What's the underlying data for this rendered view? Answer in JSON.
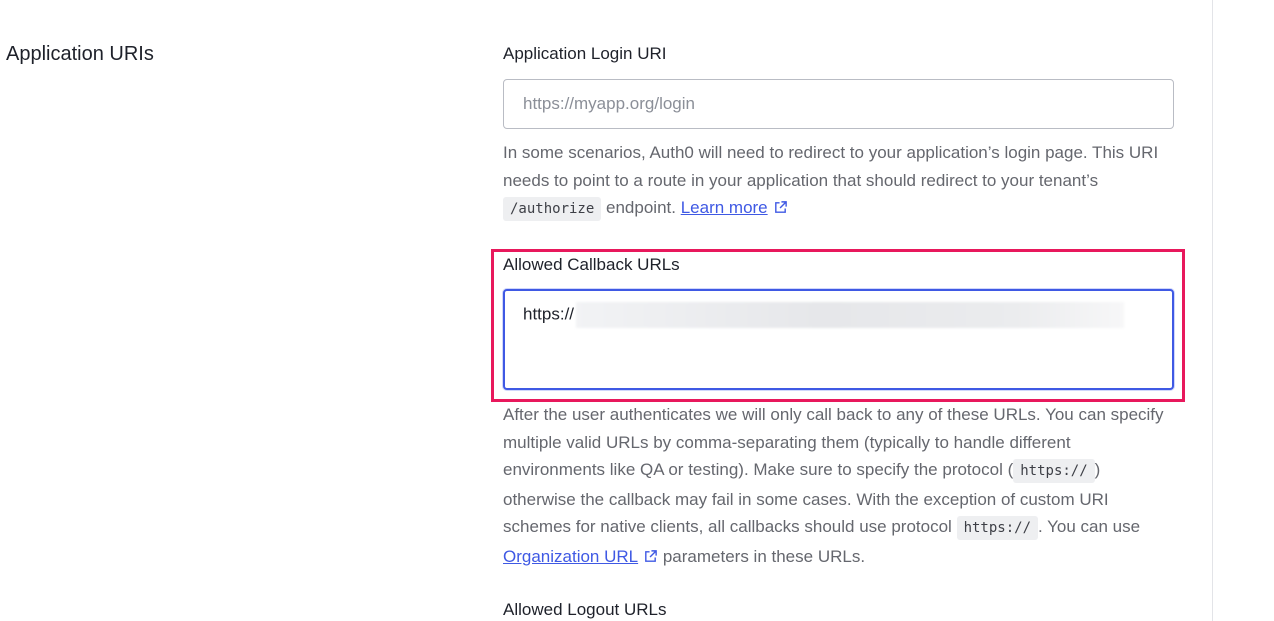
{
  "section": {
    "title": "Application URIs"
  },
  "login_uri": {
    "label": "Application Login URI",
    "placeholder": "https://myapp.org/login",
    "help": {
      "text1": "In some scenarios, Auth0 will need to redirect to your application’s login page. This URI needs to point to a route in your application that should redirect to your tenant’s ",
      "code": "/authorize",
      "text2": " endpoint. ",
      "link": "Learn more",
      "link_icon": "external-link-icon"
    }
  },
  "callback_urls": {
    "label": "Allowed Callback URLs",
    "value": "https://",
    "help": {
      "text1": "After the user authenticates we will only call back to any of these URLs. You can specify multiple valid URLs by comma-separating them (typically to handle different environments like QA or testing). Make sure to specify the protocol (",
      "code1": "https://",
      "text2": ") otherwise the callback may fail in some cases. With the exception of custom URI schemes for native clients, all callbacks should use protocol ",
      "code2": "https://",
      "text3": ". You can use ",
      "link": "Organization URL",
      "link_icon": "external-link-icon",
      "text4": " parameters in these URLs."
    }
  },
  "logout_urls": {
    "label": "Allowed Logout URLs"
  },
  "colors": {
    "accent": "#3f59e4",
    "highlight": "#e8185c"
  }
}
